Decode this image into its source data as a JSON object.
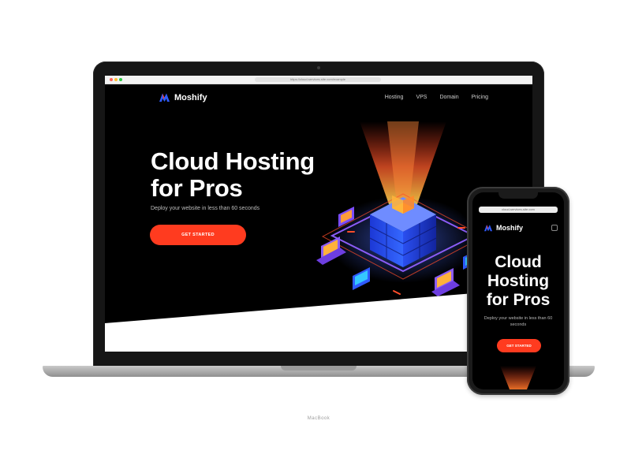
{
  "browser": {
    "url": "https://cloud-services-site.com/example"
  },
  "site": {
    "brand": "Moshify",
    "nav": [
      "Hosting",
      "VPS",
      "Domain",
      "Pricing"
    ],
    "hero": {
      "title_line1": "Cloud Hosting",
      "title_line2": "for Pros",
      "subtitle": "Deploy your website in less than 60 seconds",
      "cta": "GET STARTED"
    }
  },
  "laptop": {
    "brand": "MacBook"
  },
  "phone": {
    "url": "cloud-services-site.com",
    "title_lines": [
      "Cloud",
      "Hosting",
      "for Pros"
    ],
    "subtitle": "Deploy your website in less than 60 seconds",
    "cta": "GET STARTED"
  },
  "colors": {
    "accent": "#ff3b1f",
    "background": "#000000",
    "server_blue": "#2f5bff",
    "glow": "#ff5a2a"
  },
  "icons": [
    "moshify-logo-icon",
    "server-stack-icon",
    "menu-icon"
  ]
}
